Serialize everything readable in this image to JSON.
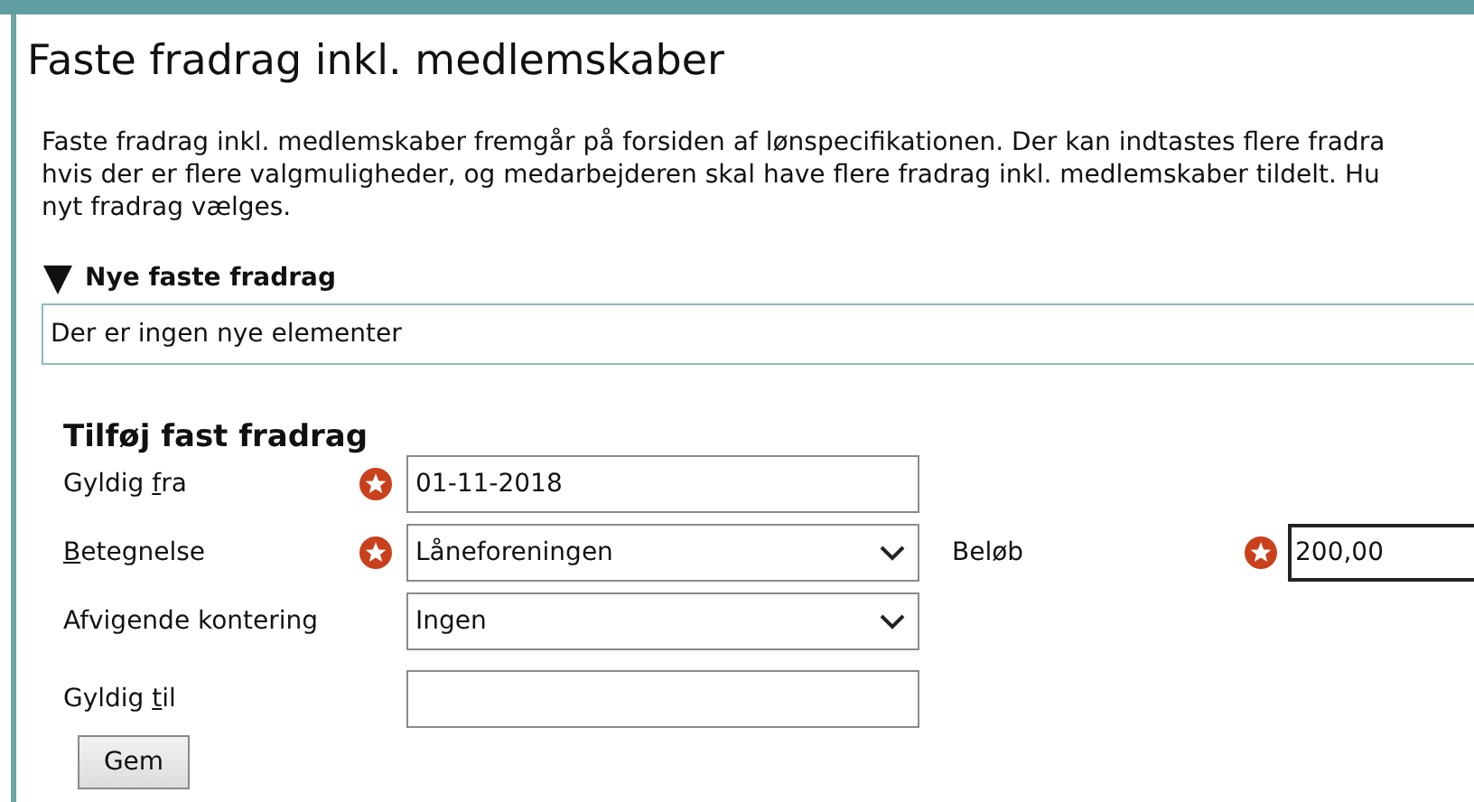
{
  "title": "Faste fradrag inkl. medlemskaber",
  "intro_lines": [
    "Faste fradrag inkl. medlemskaber fremgår på forsiden af lønspecifikationen. Der kan indtastes flere fradra",
    "hvis der er flere valgmuligheder, og medarbejderen skal have flere fradrag inkl. medlemskaber tildelt. Hu",
    "nyt fradrag vælges."
  ],
  "new_section": {
    "title": "Nye faste fradrag",
    "expanded": true,
    "message": "Der er ingen nye elementer"
  },
  "form": {
    "title": "Tilføj fast fradrag",
    "rows": [
      {
        "fields": [
          {
            "label": {
              "before": "Gyldig ",
              "key": "f",
              "after": "ra"
            },
            "required": true,
            "kind": "text",
            "value": "01-11-2018"
          }
        ]
      },
      {
        "fields": [
          {
            "label": {
              "key": "B",
              "after": "etegnelse"
            },
            "required": true,
            "kind": "select",
            "value": "Låneforeningen"
          },
          {
            "label": {
              "before": "Beløb"
            },
            "required": true,
            "kind": "text",
            "value": "200,00",
            "focused": true
          }
        ]
      },
      {
        "fields": [
          {
            "label": {
              "before": "Afvigende kontering"
            },
            "kind": "select",
            "value": "Ingen"
          }
        ]
      },
      {
        "fields": [
          {
            "label": {
              "before": "Gyldig ",
              "key": "t",
              "after": "il"
            },
            "kind": "text"
          }
        ]
      }
    ],
    "button": "Gem"
  }
}
